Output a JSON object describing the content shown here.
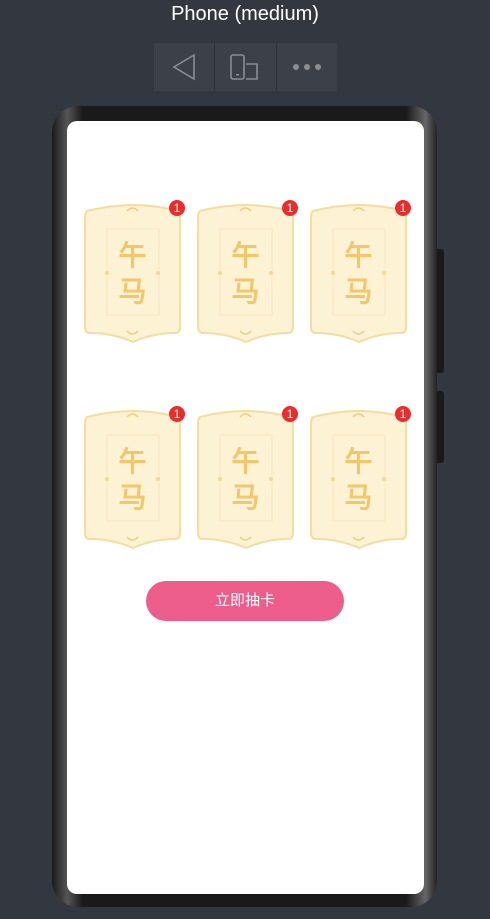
{
  "window": {
    "title": "Phone (medium)"
  },
  "toolbar": {
    "buttons": [
      {
        "icon": "back-icon"
      },
      {
        "icon": "rotate-device-icon"
      },
      {
        "icon": "more-icon"
      }
    ]
  },
  "cards": [
    {
      "line1": "午",
      "line2": "马",
      "count": "1"
    },
    {
      "line1": "午",
      "line2": "马",
      "count": "1"
    },
    {
      "line1": "午",
      "line2": "马",
      "count": "1"
    },
    {
      "line1": "午",
      "line2": "马",
      "count": "1"
    },
    {
      "line1": "午",
      "line2": "马",
      "count": "1"
    },
    {
      "line1": "午",
      "line2": "马",
      "count": "1"
    }
  ],
  "draw_button": {
    "label": "立即抽卡"
  },
  "colors": {
    "accent": "#ec5d8c",
    "badge": "#ee2b2b",
    "card": "#fdf1cf",
    "card_text": "#f2c66a"
  }
}
